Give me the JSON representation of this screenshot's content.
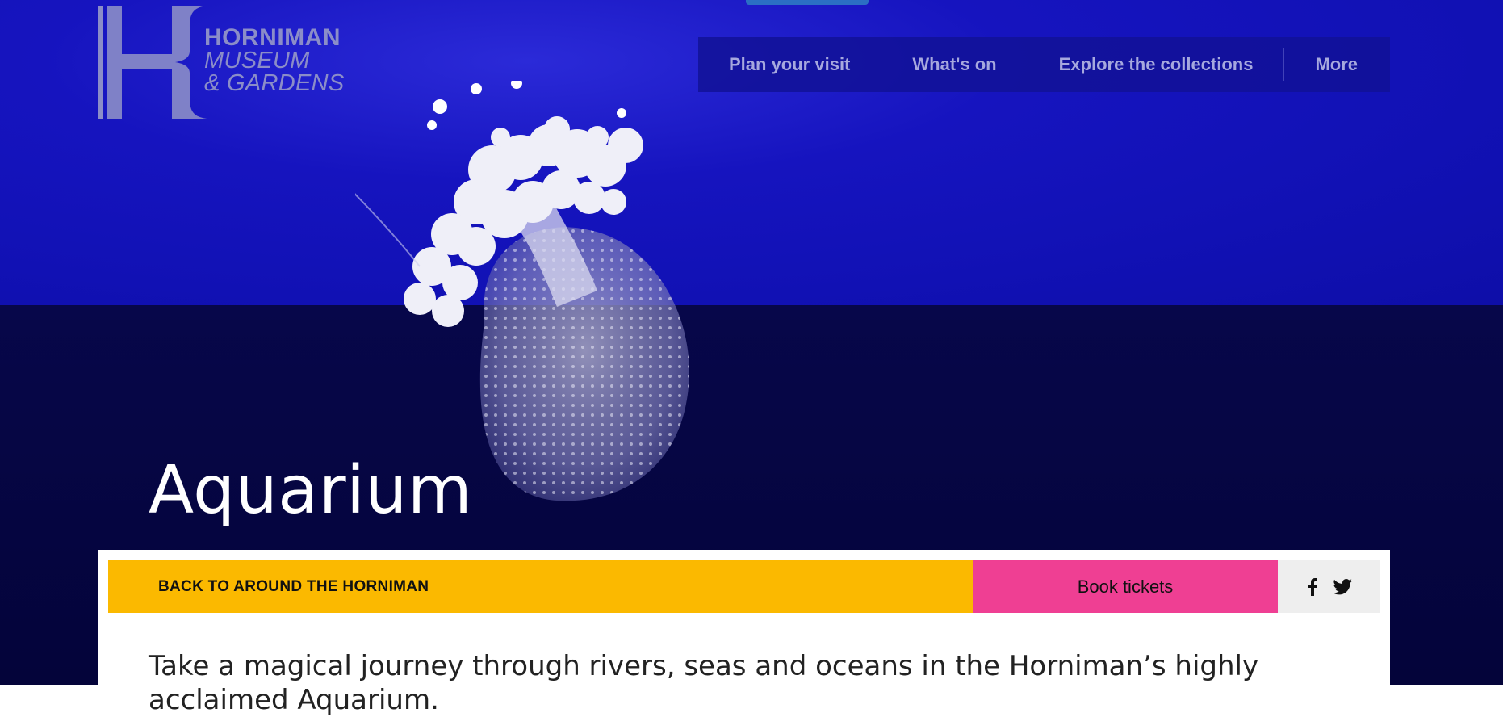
{
  "logo": {
    "line1": "HORNIMAN",
    "line2": "MUSEUM",
    "line3": "& GARDENS",
    "color": "#8b8dc8"
  },
  "nav": {
    "items": [
      {
        "label": "Plan your visit"
      },
      {
        "label": "What's on"
      },
      {
        "label": "Explore the collections"
      },
      {
        "label": "More"
      }
    ]
  },
  "hero": {
    "title": "Aquarium",
    "image": "jellyfish-photo"
  },
  "actions": {
    "back_label": "BACK TO AROUND THE HORNIMAN",
    "book_label": "Book tickets",
    "share_icons": [
      "facebook-icon",
      "twitter-icon"
    ]
  },
  "intro": {
    "text": "Take a magical journey through rivers, seas and oceans in the Horniman’s highly acclaimed Aquarium."
  },
  "colors": {
    "hero_blue": "#1614bf",
    "hero_dark": "#05053a",
    "back_bar": "#fbb900",
    "book_button": "#ef3f93",
    "share_bg": "#eeeeee"
  }
}
